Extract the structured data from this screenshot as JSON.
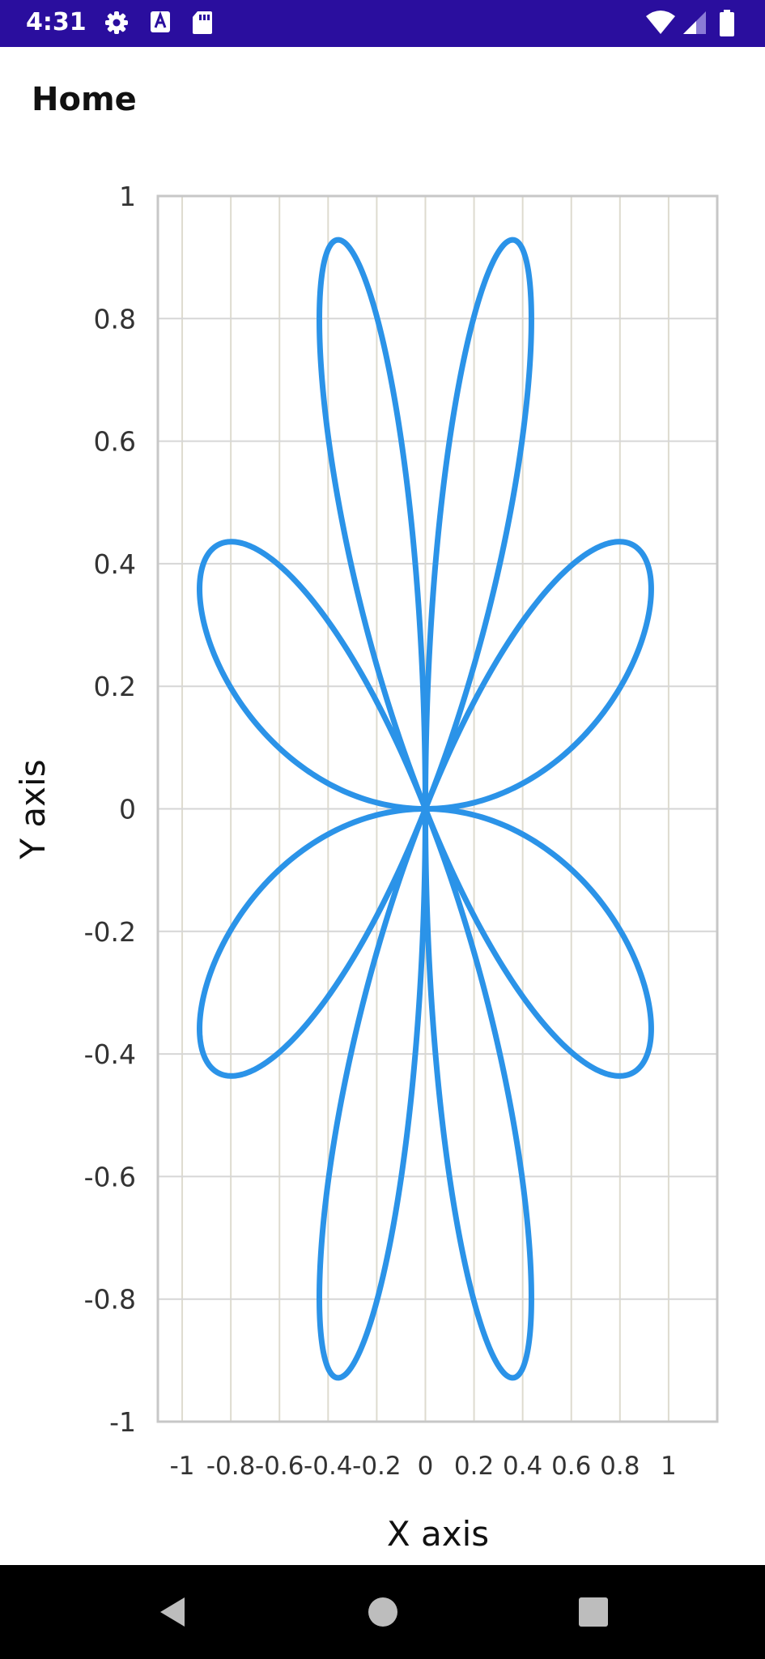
{
  "status_bar": {
    "time": "4:31",
    "left_icons": [
      "gear-icon",
      "text-icon",
      "sd-card-icon"
    ],
    "right_icons": [
      "wifi-icon",
      "signal-icon",
      "battery-icon"
    ],
    "background": "#2a0e9e"
  },
  "app_bar": {
    "title": "Home"
  },
  "navigation_bar": {
    "buttons": [
      "back-button",
      "home-button",
      "recents-button"
    ]
  },
  "chart_data": {
    "type": "line",
    "curve": "rose r = sin(4θ), θ from 0 to 2π",
    "series": [
      {
        "color": "#2b93e8",
        "line_width_note": "thick",
        "points": "computed as x = sin(4t)·cos(t), y = sin(4t)·sin(t)"
      }
    ],
    "xlabel": "X axis",
    "ylabel": "Y axis",
    "xlim": [
      -1.1,
      1.2
    ],
    "ylim": [
      -1,
      1
    ],
    "xticks": [
      -1,
      -0.8,
      -0.6,
      -0.4,
      -0.2,
      0,
      0.2,
      0.4,
      0.6,
      0.8,
      1
    ],
    "xtick_labels": [
      "-1",
      "-0.8",
      "-0.6",
      "-0.4",
      "-0.2",
      "0",
      "0.2",
      "0.4",
      "0.6",
      "0.8",
      "1"
    ],
    "yticks": [
      1,
      0.8,
      0.6,
      0.4,
      0.2,
      0,
      -0.2,
      -0.4,
      -0.6,
      -0.8,
      -1
    ],
    "ytick_labels": [
      "1",
      "0.8",
      "0.6",
      "0.4",
      "0.2",
      "0",
      "-0.2",
      "-0.4",
      "-0.6",
      "-0.8",
      "-1"
    ],
    "grid": true,
    "colors": {
      "vgrid": "#dedbcf",
      "hgrid": "#d6d6d6",
      "frame": "#c7c7c7"
    }
  }
}
